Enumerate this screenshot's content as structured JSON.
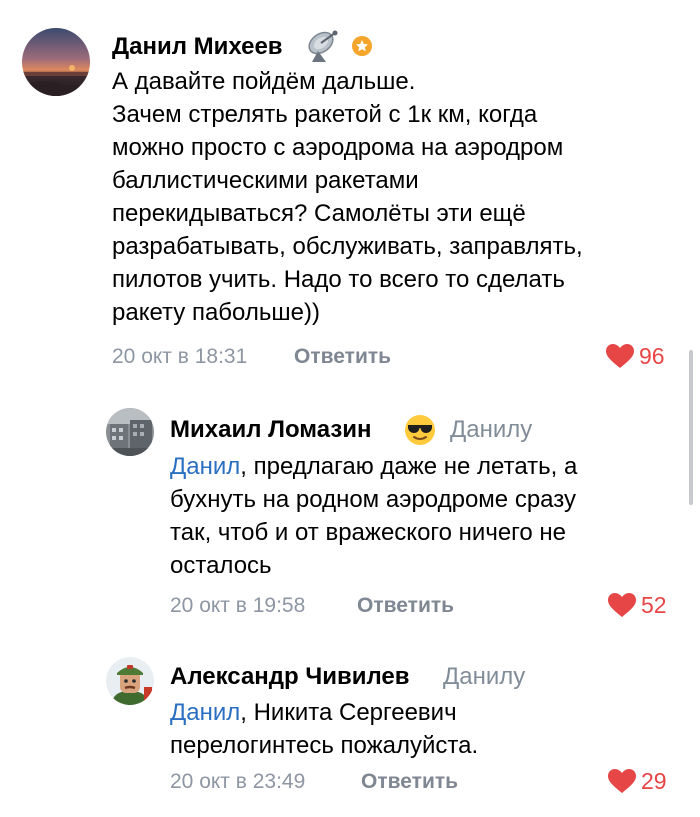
{
  "comments": [
    {
      "author": "Данил Михеев",
      "lines": [
        "А давайте пойдём дальше.",
        "Зачем стрелять ракетой с 1к км, когда",
        "можно просто с аэродрома на аэродром",
        "баллистическими ракетами",
        "перекидываться? Самолёты эти ещё",
        "разрабатывать, обслуживать, заправлять,",
        "пилотов учить. Надо то всего то сделать",
        "ракету пабольше))"
      ],
      "time": "20 окт в 18:31",
      "reply_label": "Ответить",
      "likes": "96",
      "badge_icons": [
        "satellite-dish-icon",
        "star-badge-icon"
      ]
    },
    {
      "author": "Михаил Ломазин",
      "reply_to": "Данилу",
      "mention": "Данил",
      "first_line_rest": ", предлагаю даже не летать, а",
      "lines": [
        "бухнуть на родном аэродроме сразу",
        "так, чтоб и от вражеского ничего не",
        "осталось"
      ],
      "time": "20 окт в 19:58",
      "reply_label": "Ответить",
      "likes": "52",
      "badge_icons": [
        "sunglasses-emoji-icon"
      ]
    },
    {
      "author": "Александр Чивилев",
      "reply_to": "Данилу",
      "mention": "Данил",
      "first_line_rest": ", Никита Сергеевич",
      "lines": [
        "перелогинтесь пожалуйста."
      ],
      "time": "20 окт в 23:49",
      "reply_label": "Ответить",
      "likes": "29"
    }
  ],
  "colors": {
    "like": "#e64646",
    "mention": "#2a6fc1",
    "secondary_text": "#818c99"
  }
}
